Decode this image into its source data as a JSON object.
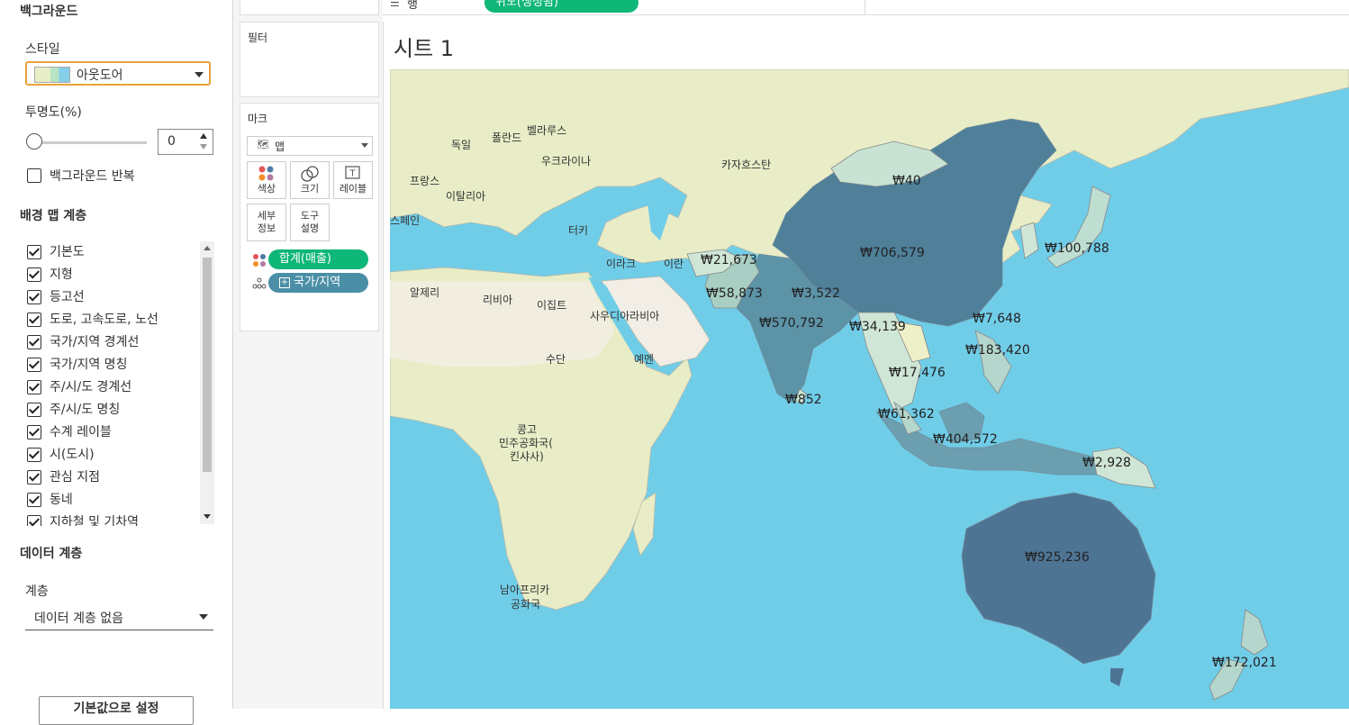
{
  "background_panel": {
    "title": "백그라운드",
    "style_label": "스타일",
    "style_value": "아웃도어",
    "opacity_label": "투명도(%)",
    "opacity_value": "0",
    "repeat_label": "백그라운드 반복",
    "layers_title": "배경 맵 계층",
    "layers": [
      {
        "label": "기본도",
        "checked": true
      },
      {
        "label": "지형",
        "checked": true
      },
      {
        "label": "등고선",
        "checked": true
      },
      {
        "label": "도로, 고속도로, 노선",
        "checked": true
      },
      {
        "label": "국가/지역 경계선",
        "checked": true
      },
      {
        "label": "국가/지역 명칭",
        "checked": true
      },
      {
        "label": "주/시/도 경계선",
        "checked": true
      },
      {
        "label": "주/시/도 명칭",
        "checked": true
      },
      {
        "label": "수계 레이블",
        "checked": true
      },
      {
        "label": "시(도시)",
        "checked": true
      },
      {
        "label": "관심 지점",
        "checked": true
      },
      {
        "label": "동네",
        "checked": true
      },
      {
        "label": "지하철 및 기차역",
        "checked": true
      }
    ],
    "data_layer_title": "데이터 계층",
    "data_layer_label": "계층",
    "data_layer_value": "데이터 계층 없음",
    "defaults_button": "기본값으로 설정"
  },
  "shelves": {
    "rows_label": "행",
    "rows_pill": "위도(생성됨)",
    "filters_title": "필터",
    "marks_title": "마크",
    "mark_type": "맵",
    "buttons": {
      "color": "색상",
      "size": "크기",
      "label": "레이블",
      "detail": "세부\n정보",
      "tooltip": "도구\n설명"
    },
    "color_pill": "합계(매출)",
    "detail_pill": "국가/지역"
  },
  "sheet": {
    "title": "시트 1"
  },
  "map_labels": {
    "countries": [
      "독일",
      "폴란드",
      "벨라루스",
      "우크라이나",
      "프랑스",
      "이탈리아",
      "스페인",
      "카자흐스탄",
      "터키",
      "이라크",
      "이란",
      "알제리",
      "리비아",
      "이집트",
      "사우디아라비아",
      "수단",
      "예멘",
      "콩고",
      "민주공화국(",
      "킨샤사)",
      "남아프리카",
      "공화국"
    ],
    "values": [
      "₩40",
      "₩706,579",
      "₩100,788",
      "₩21,673",
      "₩58,873",
      "₩3,522",
      "₩570,792",
      "₩34,139",
      "₩7,648",
      "₩183,420",
      "₩17,476",
      "₩852",
      "₩61,362",
      "₩404,572",
      "₩2,928",
      "₩925,236",
      "₩172,021"
    ]
  },
  "colors": {
    "water": "#70cde8",
    "land": "#e9edc7",
    "value_low": "#cfe6d6",
    "value_high": "#4e7494",
    "accent_green": "#0eb678",
    "accent_teal": "#4b8fa6",
    "focus_orange": "#e9a23b"
  }
}
